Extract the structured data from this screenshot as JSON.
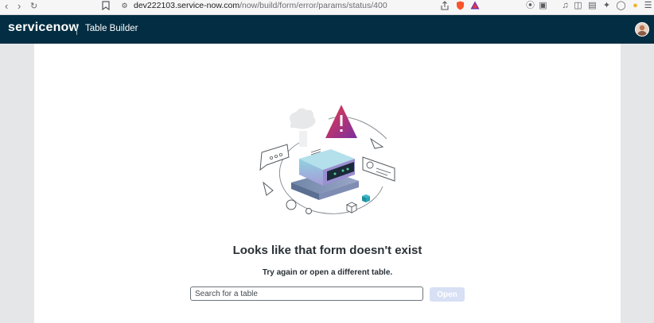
{
  "browser": {
    "url_host": "dev222103.service-now.com",
    "url_path": "/now/build/form/error/params/status/400"
  },
  "header": {
    "logo_text": "servicenow",
    "app_title": "Table Builder"
  },
  "main": {
    "heading": "Looks like that form doesn't exist",
    "subheading": "Try again or open a different table.",
    "search_placeholder": "Search for a table",
    "open_label": "Open"
  },
  "colors": {
    "header_bg": "#032d42",
    "open_button_disabled": "#d7e0f4",
    "warning_gradient_start": "#e8394a",
    "warning_gradient_end": "#7a2fa0"
  },
  "icons": [
    "back-icon",
    "forward-icon",
    "reload-icon",
    "bookmark-icon",
    "site-settings-icon",
    "share-icon",
    "brave-shield-icon",
    "brave-rewards-icon",
    "extension-icon",
    "reader-icon",
    "music-icon",
    "sidebar-icon",
    "wallet-icon",
    "leo-icon",
    "vpn-icon",
    "profile-icon",
    "menu-icon"
  ]
}
